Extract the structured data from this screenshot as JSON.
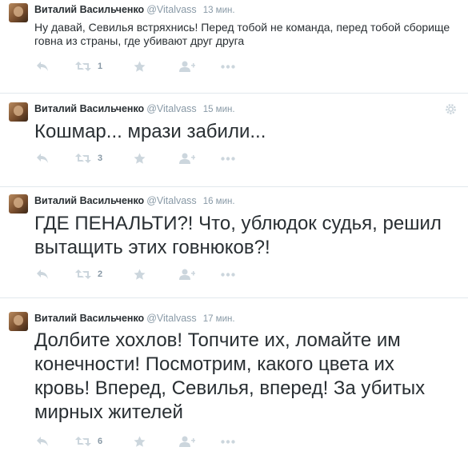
{
  "tweets": [
    {
      "name": "Виталий Васильченко",
      "handle": "@Vitalvass",
      "time": "13 мин.",
      "text": "Ну давай, Севилья встряхнись! Перед тобой не команда, перед тобой сборище говна из страны, где убивают друг друга",
      "retweets": "1"
    },
    {
      "name": "Виталий Васильченко",
      "handle": "@Vitalvass",
      "time": "15 мин.",
      "text": "Кошмар... мрази забили...",
      "retweets": "3"
    },
    {
      "name": "Виталий Васильченко",
      "handle": "@Vitalvass",
      "time": "16 мин.",
      "text": "ГДЕ ПЕНАЛЬТИ?! Что, ублюдок судья, решил вытащить этих говнюков?!",
      "retweets": "2"
    },
    {
      "name": "Виталий Васильченко",
      "handle": "@Vitalvass",
      "time": "17 мин.",
      "text": "Долбите хохлов! Топчите их, ломайте им конечности! Посмотрим, какого цвета их кровь! Вперед, Севилья, вперед! За убитых мирных жителей",
      "retweets": "6"
    }
  ],
  "icons": {
    "reply": "reply-icon",
    "retweet": "retweet-icon",
    "favorite": "star-icon",
    "follow": "follow-icon",
    "more": "more-icon",
    "settings": "gear-icon"
  },
  "colors": {
    "text": "#292f33",
    "muted": "#8899a6",
    "icon": "#ccd6dd",
    "divider": "#e1e8ed"
  }
}
